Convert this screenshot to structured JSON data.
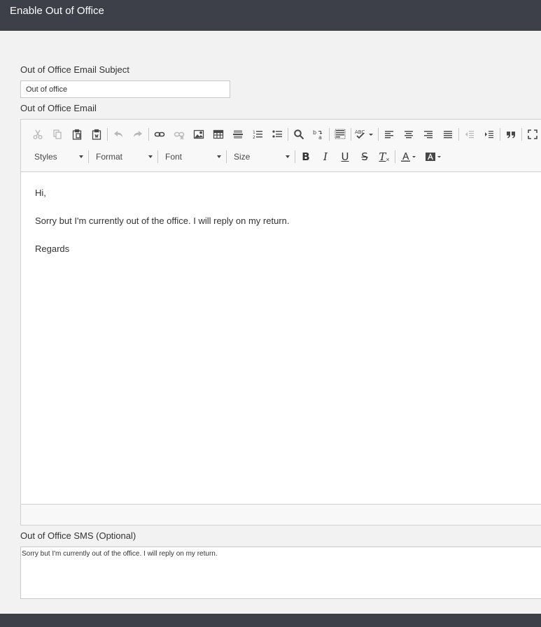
{
  "window": {
    "title": "Enable Out of Office"
  },
  "form": {
    "subject_label": "Out of Office Email Subject",
    "subject_value": "Out of office",
    "email_label": "Out of Office Email",
    "sms_label": "Out of Office SMS (Optional)",
    "sms_value": "Sorry but I'm currently out of the office. I will reply on my return."
  },
  "editor": {
    "combos": {
      "styles": "Styles",
      "format": "Format",
      "font": "Font",
      "size": "Size"
    },
    "format_buttons": {
      "bold": "B",
      "italic": "I",
      "underline": "U",
      "strike": "S",
      "clear": "T"
    },
    "body": {
      "greeting": "Hi,",
      "message": "Sorry but I'm currently out of the office. I will reply on my return.",
      "closing": "Regards"
    }
  },
  "colors": {
    "titlebar": "#3d4049",
    "background": "#f2f2f2",
    "toolbar": "#f8f8f8"
  }
}
